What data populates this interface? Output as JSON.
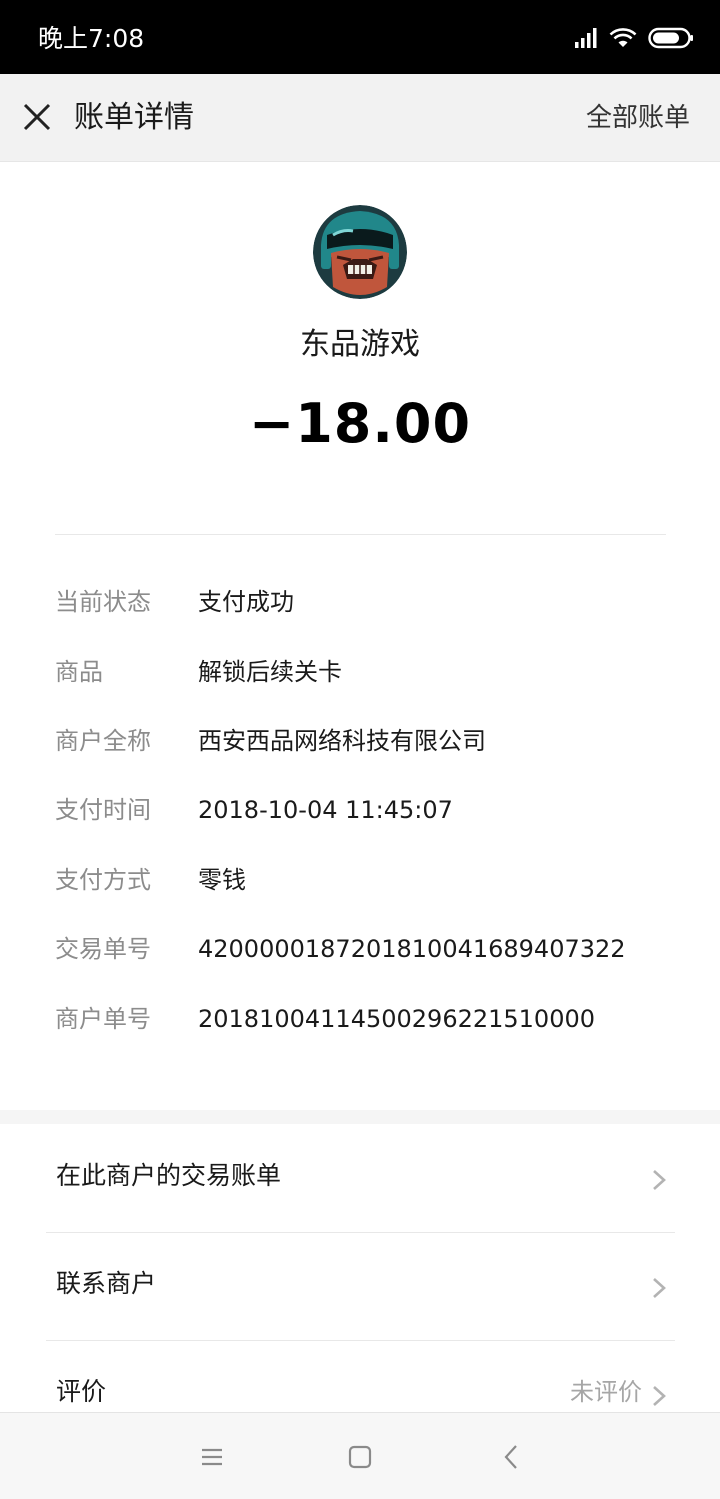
{
  "status_bar": {
    "time": "晚上7:08",
    "icons": [
      "signal-icon",
      "wifi-icon",
      "battery-icon"
    ]
  },
  "header": {
    "close_icon": "close-icon",
    "title": "账单详情",
    "all_bills_label": "全部账单"
  },
  "merchant": {
    "avatar_icon": "merchant-avatar",
    "name": "东品游戏",
    "amount": "−18.00"
  },
  "details": [
    {
      "label": "当前状态",
      "value": "支付成功"
    },
    {
      "label": "商品",
      "value": "解锁后续关卡"
    },
    {
      "label": "商户全称",
      "value": "西安西品网络科技有限公司"
    },
    {
      "label": "支付时间",
      "value": "2018-10-04 11:45:07"
    },
    {
      "label": "支付方式",
      "value": "零钱"
    },
    {
      "label": "交易单号",
      "value": "4200000187201810041689407322"
    },
    {
      "label": "商户单号",
      "value": "20181004114500296221510000"
    }
  ],
  "actions": [
    {
      "label": "在此商户的交易账单",
      "sub": ""
    },
    {
      "label": "联系商户",
      "sub": ""
    },
    {
      "label": "评价",
      "sub": "未评价"
    }
  ],
  "nav": {
    "menu_icon": "menu-icon",
    "home_icon": "home-icon",
    "back_icon": "back-icon"
  },
  "colors": {
    "status_bar_bg": "#000000",
    "title_bar_bg": "#f2f2f2",
    "label_gray": "#8c8c8c",
    "text_dark": "#1a1a1a"
  }
}
